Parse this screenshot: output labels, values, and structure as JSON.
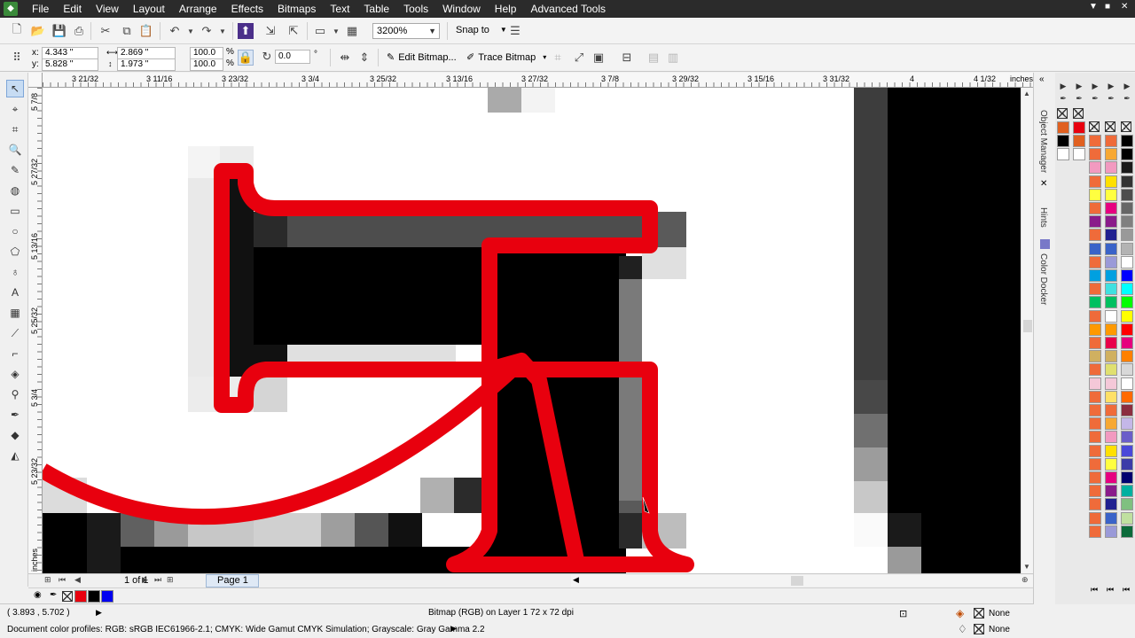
{
  "menu": [
    "File",
    "Edit",
    "View",
    "Layout",
    "Arrange",
    "Effects",
    "Bitmaps",
    "Text",
    "Table",
    "Tools",
    "Window",
    "Help",
    "Advanced Tools"
  ],
  "window_controls": [
    "▼",
    "■",
    "✕"
  ],
  "standard_toolbar": {
    "zoom_value": "3200%",
    "snap_to_label": "Snap to"
  },
  "property_bar": {
    "x_label": "x:",
    "x_value": "4.343 \"",
    "y_label": "y:",
    "y_value": "5.828 \"",
    "width_value": "2.869 \"",
    "height_value": "1.973 \"",
    "scale_x": "100.0",
    "scale_y": "100.0",
    "percent": "%",
    "rotation_value": "0.0",
    "degree": "°",
    "edit_bitmap_label": "Edit Bitmap...",
    "trace_bitmap_label": "Trace Bitmap"
  },
  "ruler": {
    "units": "inches",
    "h_labels": [
      "3 21/32",
      "3 11/16",
      "3 23/32",
      "3 3/4",
      "3 25/32",
      "3 13/16",
      "3 27/32",
      "3 7/8",
      "3 29/32",
      "3 15/16",
      "3 31/32",
      "4",
      "4 1/32"
    ],
    "v_labels": [
      "5 7/8",
      "5 27/32",
      "5 13/16",
      "5 25/32",
      "5 3/4",
      "5 23/32"
    ],
    "v_units": "inches"
  },
  "page_nav": {
    "page_count": "1 of 1",
    "page_tab": "Page 1"
  },
  "status": {
    "coords": "( 3.893 , 5.702 )",
    "object_info": "Bitmap (RGB) on Layer 1 72 x 72 dpi",
    "color_profiles": "Document color profiles: RGB: sRGB IEC61966-2.1; CMYK: Wide Gamut CMYK Simulation; Grayscale: Gray Gamma 2.2",
    "fill_label": "None",
    "outline_label": "None"
  },
  "dockers": [
    "Object Manager",
    "Hints",
    "Color Docker"
  ],
  "document_colors": [
    "#e8000e",
    "#000000",
    "#0000f0"
  ],
  "palette_main": [
    "#000000",
    "#000000",
    "#1a1a1a",
    "#333333",
    "#4d4d4d",
    "#666666",
    "#808080",
    "#999999",
    "#b3b3b3",
    "#ffffff",
    "#0000ff",
    "#00ffff",
    "#00ff00",
    "#ffff00",
    "#ff0000",
    "#e6007e",
    "#ff8000",
    "#d8d8d8",
    "#ffffff",
    "#ff6a00",
    "#8b2d3f",
    "#c4b7e8",
    "#6b5ec9",
    "#4a48d9",
    "#3c3ca8",
    "#000070",
    "#00b0a0",
    "#7fc080",
    "#c0e0a0",
    "#0b6a3a"
  ],
  "palette_accent": [
    "#ef6b3a",
    "#f7a833",
    "#f29ac0",
    "#ffe000",
    "#ffff40",
    "#e60080",
    "#8a1b8a",
    "#202090",
    "#3a63c8",
    "#9a9ad8",
    "#00a0e0",
    "#40e0e0",
    "#00c060",
    "#ffffff",
    "#ff9900",
    "#e8004a",
    "#d0b060",
    "#e0e070",
    "#f4c8d8",
    "#ffe066"
  ]
}
